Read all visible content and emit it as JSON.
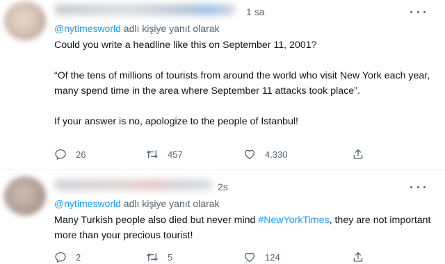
{
  "tweets": [
    {
      "time": "1 sa",
      "reply_handle": "@nytimesworld",
      "reply_suffix": " adlı kişiye yanıt olarak",
      "lines": [
        "Could you write a headline like this on September 11, 2001?",
        "“Of the tens of millions of tourists from around the world who visit New York each year, many spend time in the area where September 11 attacks took place”.",
        "If your answer is no, apologize to the people of Istanbul!"
      ],
      "stats": {
        "replies": "26",
        "retweets": "457",
        "likes": "4.330"
      }
    },
    {
      "time": "2s",
      "reply_handle": "@nytimesworld",
      "reply_suffix": " adlı kişiye yanıt olarak",
      "text_before": "Many Turkish people also died but never mind ",
      "hashtag": "#NewYorkTimes",
      "text_after": ", they are not important more than your precious tourist!",
      "stats": {
        "replies": "2",
        "retweets": "5",
        "likes": "124"
      }
    }
  ],
  "icons": {
    "reply": "speech-bubble",
    "retweet": "retweet-arrows",
    "like": "heart",
    "share": "upload-arrow",
    "more": "three-dots"
  },
  "colors": {
    "link": "#1d9bf0",
    "text": "#0f1419",
    "muted": "#536471",
    "divider": "#eff3f4"
  }
}
